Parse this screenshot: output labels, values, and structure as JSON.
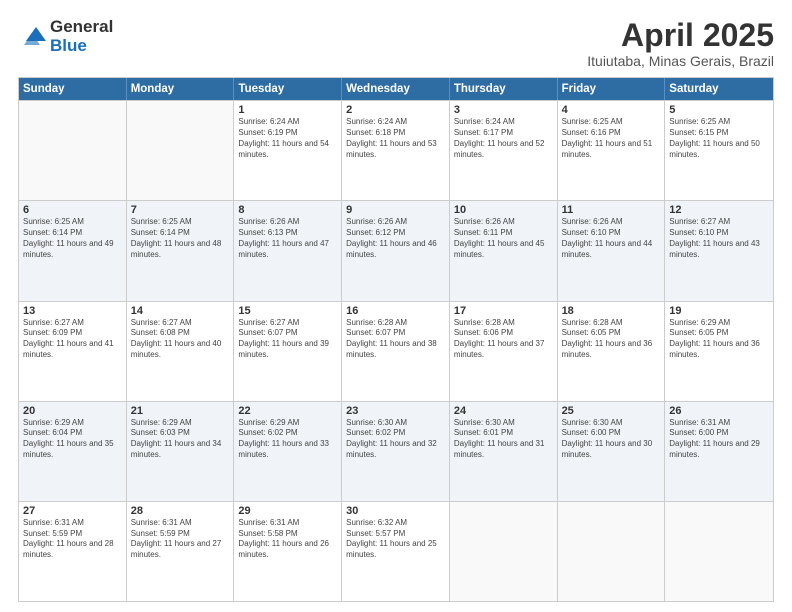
{
  "logo": {
    "general": "General",
    "blue": "Blue"
  },
  "title": {
    "month": "April 2025",
    "location": "Ituiutaba, Minas Gerais, Brazil"
  },
  "calendar": {
    "headers": [
      "Sunday",
      "Monday",
      "Tuesday",
      "Wednesday",
      "Thursday",
      "Friday",
      "Saturday"
    ],
    "rows": [
      [
        {
          "day": "",
          "info": ""
        },
        {
          "day": "",
          "info": ""
        },
        {
          "day": "1",
          "info": "Sunrise: 6:24 AM\nSunset: 6:19 PM\nDaylight: 11 hours and 54 minutes."
        },
        {
          "day": "2",
          "info": "Sunrise: 6:24 AM\nSunset: 6:18 PM\nDaylight: 11 hours and 53 minutes."
        },
        {
          "day": "3",
          "info": "Sunrise: 6:24 AM\nSunset: 6:17 PM\nDaylight: 11 hours and 52 minutes."
        },
        {
          "day": "4",
          "info": "Sunrise: 6:25 AM\nSunset: 6:16 PM\nDaylight: 11 hours and 51 minutes."
        },
        {
          "day": "5",
          "info": "Sunrise: 6:25 AM\nSunset: 6:15 PM\nDaylight: 11 hours and 50 minutes."
        }
      ],
      [
        {
          "day": "6",
          "info": "Sunrise: 6:25 AM\nSunset: 6:14 PM\nDaylight: 11 hours and 49 minutes."
        },
        {
          "day": "7",
          "info": "Sunrise: 6:25 AM\nSunset: 6:14 PM\nDaylight: 11 hours and 48 minutes."
        },
        {
          "day": "8",
          "info": "Sunrise: 6:26 AM\nSunset: 6:13 PM\nDaylight: 11 hours and 47 minutes."
        },
        {
          "day": "9",
          "info": "Sunrise: 6:26 AM\nSunset: 6:12 PM\nDaylight: 11 hours and 46 minutes."
        },
        {
          "day": "10",
          "info": "Sunrise: 6:26 AM\nSunset: 6:11 PM\nDaylight: 11 hours and 45 minutes."
        },
        {
          "day": "11",
          "info": "Sunrise: 6:26 AM\nSunset: 6:10 PM\nDaylight: 11 hours and 44 minutes."
        },
        {
          "day": "12",
          "info": "Sunrise: 6:27 AM\nSunset: 6:10 PM\nDaylight: 11 hours and 43 minutes."
        }
      ],
      [
        {
          "day": "13",
          "info": "Sunrise: 6:27 AM\nSunset: 6:09 PM\nDaylight: 11 hours and 41 minutes."
        },
        {
          "day": "14",
          "info": "Sunrise: 6:27 AM\nSunset: 6:08 PM\nDaylight: 11 hours and 40 minutes."
        },
        {
          "day": "15",
          "info": "Sunrise: 6:27 AM\nSunset: 6:07 PM\nDaylight: 11 hours and 39 minutes."
        },
        {
          "day": "16",
          "info": "Sunrise: 6:28 AM\nSunset: 6:07 PM\nDaylight: 11 hours and 38 minutes."
        },
        {
          "day": "17",
          "info": "Sunrise: 6:28 AM\nSunset: 6:06 PM\nDaylight: 11 hours and 37 minutes."
        },
        {
          "day": "18",
          "info": "Sunrise: 6:28 AM\nSunset: 6:05 PM\nDaylight: 11 hours and 36 minutes."
        },
        {
          "day": "19",
          "info": "Sunrise: 6:29 AM\nSunset: 6:05 PM\nDaylight: 11 hours and 36 minutes."
        }
      ],
      [
        {
          "day": "20",
          "info": "Sunrise: 6:29 AM\nSunset: 6:04 PM\nDaylight: 11 hours and 35 minutes."
        },
        {
          "day": "21",
          "info": "Sunrise: 6:29 AM\nSunset: 6:03 PM\nDaylight: 11 hours and 34 minutes."
        },
        {
          "day": "22",
          "info": "Sunrise: 6:29 AM\nSunset: 6:02 PM\nDaylight: 11 hours and 33 minutes."
        },
        {
          "day": "23",
          "info": "Sunrise: 6:30 AM\nSunset: 6:02 PM\nDaylight: 11 hours and 32 minutes."
        },
        {
          "day": "24",
          "info": "Sunrise: 6:30 AM\nSunset: 6:01 PM\nDaylight: 11 hours and 31 minutes."
        },
        {
          "day": "25",
          "info": "Sunrise: 6:30 AM\nSunset: 6:00 PM\nDaylight: 11 hours and 30 minutes."
        },
        {
          "day": "26",
          "info": "Sunrise: 6:31 AM\nSunset: 6:00 PM\nDaylight: 11 hours and 29 minutes."
        }
      ],
      [
        {
          "day": "27",
          "info": "Sunrise: 6:31 AM\nSunset: 5:59 PM\nDaylight: 11 hours and 28 minutes."
        },
        {
          "day": "28",
          "info": "Sunrise: 6:31 AM\nSunset: 5:59 PM\nDaylight: 11 hours and 27 minutes."
        },
        {
          "day": "29",
          "info": "Sunrise: 6:31 AM\nSunset: 5:58 PM\nDaylight: 11 hours and 26 minutes."
        },
        {
          "day": "30",
          "info": "Sunrise: 6:32 AM\nSunset: 5:57 PM\nDaylight: 11 hours and 25 minutes."
        },
        {
          "day": "",
          "info": ""
        },
        {
          "day": "",
          "info": ""
        },
        {
          "day": "",
          "info": ""
        }
      ]
    ]
  }
}
